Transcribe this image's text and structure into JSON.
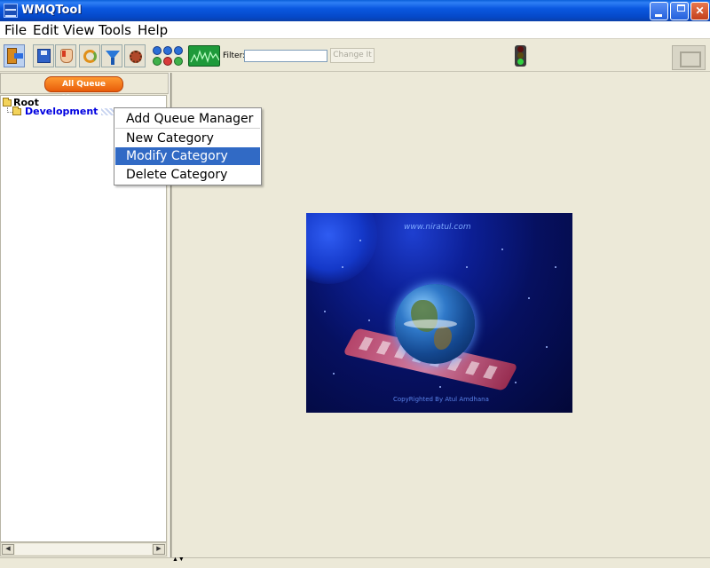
{
  "window": {
    "title": "WMQTool",
    "controls": {
      "minimize": "minimize",
      "maximize": "restore",
      "close": "close"
    }
  },
  "menubar": {
    "items": [
      {
        "label": "File"
      },
      {
        "label": "Edit"
      },
      {
        "label": "View"
      },
      {
        "label": "Tools"
      },
      {
        "label": "Help"
      }
    ]
  },
  "toolbar": {
    "filter_label": "Filter:",
    "filter_value": "",
    "change_button_label": "Change It",
    "icons": [
      "exit-icon",
      "save-icon",
      "hand-icon",
      "refresh-icon",
      "filter-icon",
      "gear-icon",
      "queue-status-icon",
      "graph-icon",
      "traffic-light-icon"
    ]
  },
  "left_panel": {
    "header_button_label": "All Queue Managers",
    "tree": {
      "root_label": "Root",
      "children": [
        {
          "label": "Development"
        }
      ]
    }
  },
  "context_menu": {
    "items": [
      {
        "label": "Add Queue Manager",
        "highlighted": false
      },
      {
        "label": "New Category",
        "highlighted": false
      },
      {
        "label": "Modify Category",
        "highlighted": true
      },
      {
        "label": "Delete Category",
        "highlighted": false
      }
    ]
  },
  "splash": {
    "url_text": "www.niratul.com",
    "copyright_text": "CopyRighted By Atul Amdhana"
  },
  "colors": {
    "titlebar": "#0a58e0",
    "menu_highlight": "#316ac5",
    "tree_child_text": "#0000e0",
    "orange_button": "#e85c0a",
    "panel_bg": "#ece9d8"
  }
}
